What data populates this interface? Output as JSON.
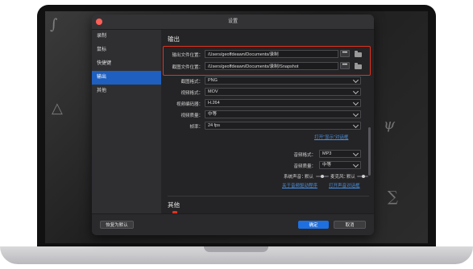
{
  "window": {
    "title": "设置"
  },
  "sidebar": {
    "items": [
      {
        "label": "录制"
      },
      {
        "label": "鼠标"
      },
      {
        "label": "快捷键"
      },
      {
        "label": "输出"
      },
      {
        "label": "其他"
      }
    ],
    "active_index": 3
  },
  "output": {
    "section_title": "输出",
    "output_folder": {
      "label": "输出文件位置：",
      "value": "/Users/geoffdeawn/Documents/录制"
    },
    "snapshot_folder": {
      "label": "截图文件位置：",
      "value": "/Users/geoffdeawn/Documents/录制/Snapshot"
    },
    "browse_label": "•••",
    "screenshot_format": {
      "label": "截图格式：",
      "value": "PNG"
    },
    "video_format": {
      "label": "视频格式：",
      "value": "MOV"
    },
    "video_codec": {
      "label": "视频编码器：",
      "value": "H.264"
    },
    "video_quality": {
      "label": "视频质量：",
      "value": "中等"
    },
    "frame_rate": {
      "label": "帧率：",
      "value": "24 fps"
    },
    "show_dialog_link": "打开\"显示\"对话框",
    "audio_format": {
      "label": "音频格式：",
      "value": "MP3"
    },
    "audio_quality": {
      "label": "音频质量：",
      "value": "中等"
    },
    "system_sound": {
      "label": "系统声音：",
      "value": "默认"
    },
    "microphone": {
      "label": "麦克风：",
      "value": "默认"
    },
    "audio_driver_link": "关于音频驱动程序",
    "open_sound_dialog_link": "打开声音对话框"
  },
  "other": {
    "section_title": "其他"
  },
  "footer": {
    "reset_label": "恢复为默认",
    "ok_label": "确定",
    "cancel_label": "取消"
  },
  "colors": {
    "accent": "#1e6fe0",
    "highlight_box": "#e2311d",
    "sidebar_active": "#1e5fbf"
  }
}
